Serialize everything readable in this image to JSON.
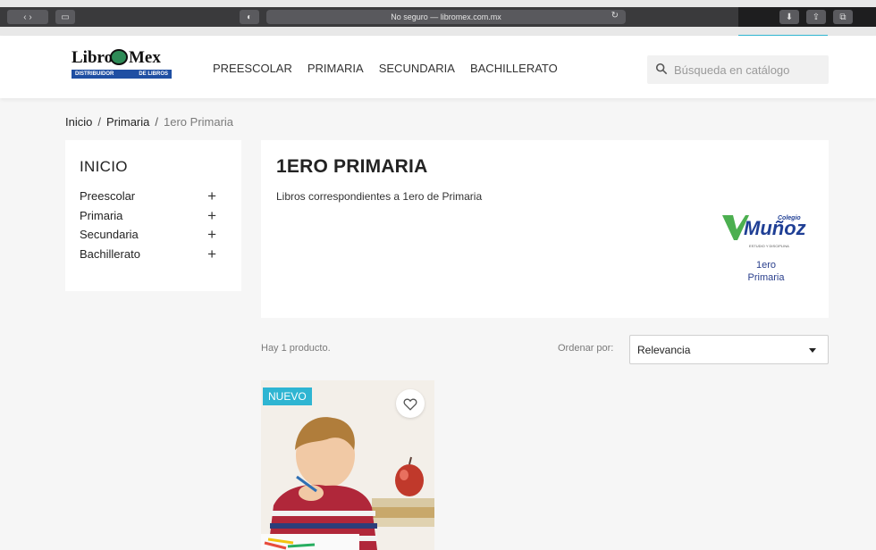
{
  "browser": {
    "url_text": "No seguro — libromex.com.mx"
  },
  "logo": {
    "name_left": "Libro",
    "name_right": "Mex",
    "banner_left": "DISTRIBUIDOR",
    "banner_right": "DE LIBROS"
  },
  "nav": [
    "PREESCOLAR",
    "PRIMARIA",
    "SECUNDARIA",
    "BACHILLERATO"
  ],
  "search": {
    "placeholder": "Búsqueda en catálogo"
  },
  "breadcrumb": [
    "Inicio",
    "Primaria",
    "1ero Primaria"
  ],
  "sidebar": {
    "title": "INICIO",
    "categories": [
      "Preescolar",
      "Primaria",
      "Secundaria",
      "Bachillerato"
    ]
  },
  "category": {
    "title": "1ERO PRIMARIA",
    "description": "Libros correspondientes a 1ero de Primaria",
    "logo": {
      "school_name": "Muñoz",
      "school_prefix": "Colegio",
      "tagline": "ESTUDIO Y DISCIPLINA",
      "grade_line1": "1ero",
      "grade_line2": "Primaria"
    }
  },
  "products_bar": {
    "count_text": "Hay 1 producto.",
    "sort_label": "Ordenar por:",
    "sort_selected": "Relevancia"
  },
  "product": {
    "badge": "NUEVO"
  },
  "colors": {
    "accent": "#2fb5d2",
    "brand_blue": "#1f4fa3",
    "school_blue": "#1f3f95",
    "school_green": "#4caf50"
  }
}
